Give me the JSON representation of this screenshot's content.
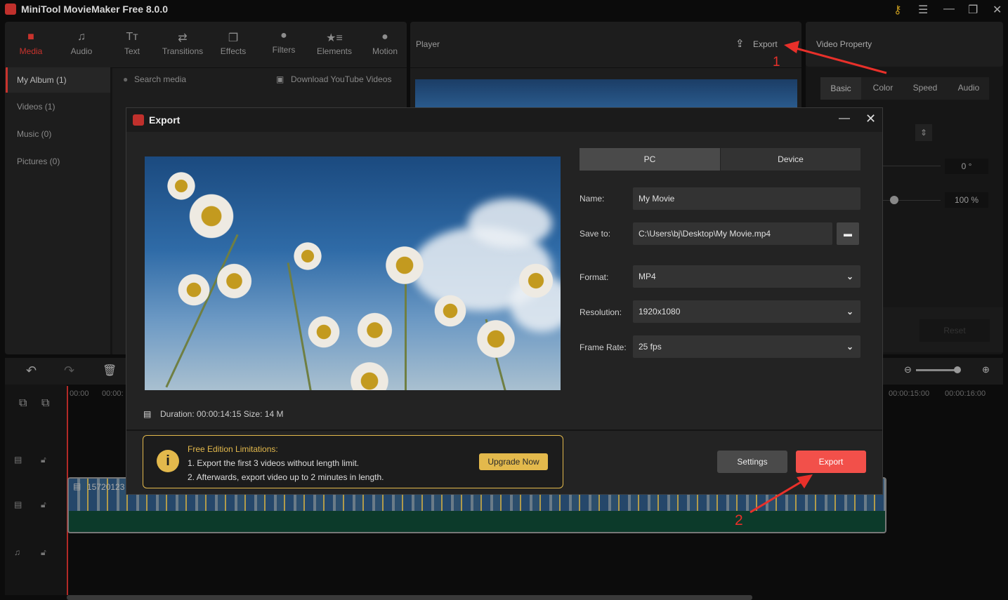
{
  "window": {
    "title": "MiniTool MovieMaker Free 8.0.0",
    "icons": [
      "key-icon",
      "menu-icon",
      "minimize-icon",
      "maximize-icon",
      "close-icon"
    ]
  },
  "toolbar": {
    "tabs": [
      {
        "label": "Media",
        "icon": "folder-icon"
      },
      {
        "label": "Audio",
        "icon": "music-icon"
      },
      {
        "label": "Text",
        "icon": "text-icon"
      },
      {
        "label": "Transitions",
        "icon": "transitions-icon"
      },
      {
        "label": "Effects",
        "icon": "effects-icon"
      },
      {
        "label": "Filters",
        "icon": "filters-icon"
      },
      {
        "label": "Elements",
        "icon": "elements-icon"
      },
      {
        "label": "Motion",
        "icon": "motion-icon"
      }
    ],
    "accent": "#c9332d"
  },
  "sidebar": {
    "items": [
      "My Album (1)",
      "Videos (1)",
      "Music (0)",
      "Pictures (0)"
    ]
  },
  "media": {
    "search_placeholder": "Search media",
    "download": "Download YouTube Videos"
  },
  "player": {
    "title": "Player",
    "export": "Export"
  },
  "property": {
    "title": "Video Property",
    "tabs": [
      "Basic",
      "Color",
      "Speed",
      "Audio"
    ],
    "rotation": "0 °",
    "scale": "100 %",
    "reset": "Reset"
  },
  "timeline": {
    "ticks": [
      "00:00",
      "00:00:",
      "00:00:15:00",
      "00:00:16:00"
    ],
    "clip": "15720123"
  },
  "annotations": {
    "one": "1",
    "two": "2",
    "color": "#e8302a"
  },
  "dialog": {
    "title": "Export",
    "tabs": [
      "PC",
      "Device"
    ],
    "name_label": "Name:",
    "name": "My Movie",
    "save_label": "Save to:",
    "save": "C:\\Users\\bj\\Desktop\\My Movie.mp4",
    "format_label": "Format:",
    "format": "MP4",
    "resolution_label": "Resolution:",
    "resolution": "1920x1080",
    "framerate_label": "Frame Rate:",
    "framerate": "25 fps",
    "duration": "Duration:  00:00:14:15  Size:  14 M",
    "limit_title": "Free Edition Limitations:",
    "limit1": "1. Export the first 3 videos without length limit.",
    "limit2": "2. Afterwards, export video up to 2 minutes in length.",
    "upgrade": "Upgrade Now",
    "settings": "Settings",
    "export": "Export",
    "export_color": "#f2504a",
    "gold": "#e3b94c"
  }
}
